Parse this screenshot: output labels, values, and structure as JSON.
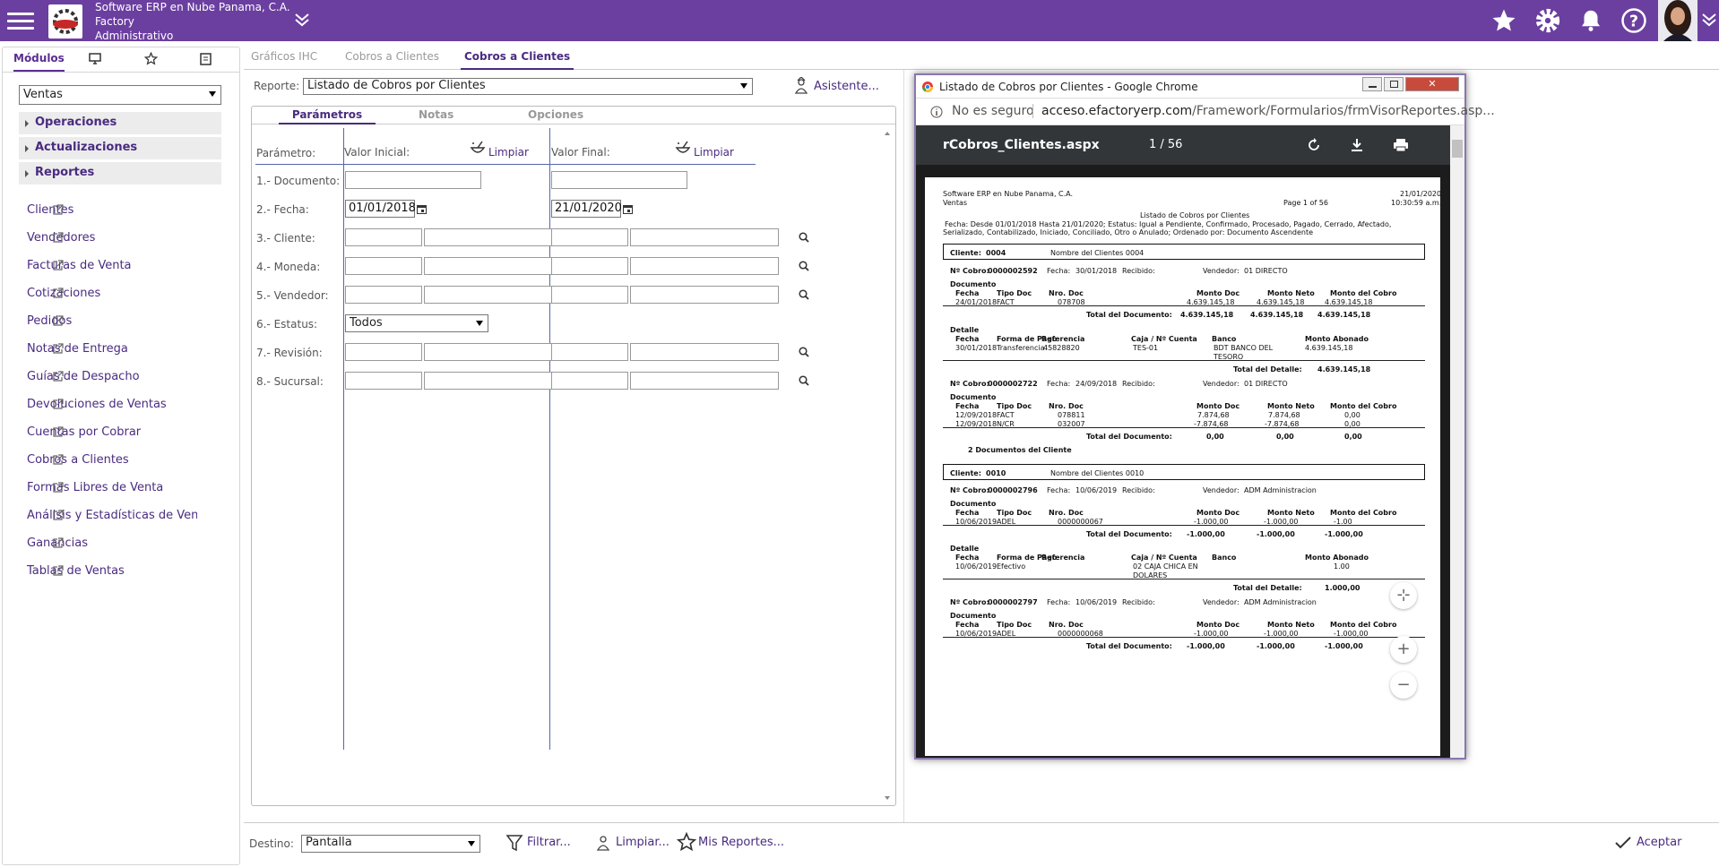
{
  "header": {
    "company_line1": "Software ERP en Nube Panama, C.A.",
    "company_line2": "Factory",
    "company_line3": "Administrativo"
  },
  "sidebar": {
    "tabs": [
      {
        "label": "Módulos"
      }
    ],
    "module_select": "Ventas",
    "groups": [
      {
        "label": "Operaciones"
      },
      {
        "label": "Actualizaciones"
      },
      {
        "label": "Reportes"
      }
    ],
    "items": [
      {
        "label": "Clientes"
      },
      {
        "label": "Vendedores"
      },
      {
        "label": "Facturas de Venta"
      },
      {
        "label": "Cotizaciones"
      },
      {
        "label": "Pedidos"
      },
      {
        "label": "Notas de Entrega"
      },
      {
        "label": "Guías de Despacho"
      },
      {
        "label": "Devoluciones de Ventas"
      },
      {
        "label": "Cuentas por Cobrar"
      },
      {
        "label": "Cobros a Clientes"
      },
      {
        "label": "Formas Libres de Venta"
      },
      {
        "label": "Análisis y Estadísticas de Ventas"
      },
      {
        "label": "Ganancias"
      },
      {
        "label": "Tablas de Ventas"
      }
    ]
  },
  "main": {
    "tabs": [
      {
        "label": "Gráficos IHC"
      },
      {
        "label": "Cobros a Clientes"
      },
      {
        "label": "Cobros a Clientes"
      }
    ],
    "report_label": "Reporte:",
    "report_value": "Listado de Cobros por Clientes",
    "wizard_label": "Asistente...",
    "panel_tabs": [
      {
        "label": "Parámetros"
      },
      {
        "label": "Notas"
      },
      {
        "label": "Opciones"
      }
    ],
    "param_header": "Parámetro:",
    "initial_header": "Valor Inicial:",
    "final_header": "Valor Final:",
    "clear_label": "Limpiar",
    "params": [
      {
        "label": "1.- Documento:"
      },
      {
        "label": "2.- Fecha:"
      },
      {
        "label": "3.- Cliente:"
      },
      {
        "label": "4.- Moneda:"
      },
      {
        "label": "5.- Vendedor:"
      },
      {
        "label": "6.- Estatus:"
      },
      {
        "label": "7.- Revisión:"
      },
      {
        "label": "8.- Sucursal:"
      }
    ],
    "date_initial": "01/01/2018",
    "date_final": "21/01/2020",
    "estatus_value": "Todos"
  },
  "bottom": {
    "destino_label": "Destino:",
    "destino_value": "Pantalla",
    "filter_label": "Filtrar...",
    "clear_label": "Limpiar...",
    "myreports_label": "Mis Reportes...",
    "accept_label": "Aceptar"
  },
  "pdf": {
    "window_title": "Listado de Cobros por Clientes - Google Chrome",
    "not_secure": "No es seguro",
    "url_host": "acceso.efactoryerp.com",
    "url_path": "/Framework/Formularios/frmVisorReportes.asp...",
    "filename": "rCobros_Clientes.aspx",
    "pages": "1 / 56",
    "doc": {
      "company": "Software ERP en Nube Panama, C.A.",
      "module": "Ventas",
      "date": "21/01/2020",
      "time": "10:30:59 a.m.",
      "page": "Page 1 of 56",
      "title": "Listado de Cobros por Clientes",
      "filter1": "Fecha: Desde 01/01/2018  Hasta 21/01/2020; Estatus: Igual a Pendiente, Confirmado, Procesado, Pagado, Cerrado, Afectado,",
      "filter2": "Serializado, Contabilizado, Iniciado, Conciliado, Otro o Anulado; Ordenado por: Documento Ascendente",
      "cliente_lbl": "Cliente:",
      "c1_code": "0004",
      "c1_name": "Nombre del Clientes 0004",
      "c2_code": "0010",
      "c2_name": "Nombre del Clientes 0010",
      "cobro_lbl": "Nº Cobro:",
      "fecha_lbl": "Fecha:",
      "recibido_lbl": "Recibido:",
      "vendedor_lbl": "Vendedor:",
      "documento_lbl": "Documento",
      "detalle_lbl": "Detalle",
      "h_fecha": "Fecha",
      "h_tipo": "Tipo Doc",
      "h_nro": "Nro. Doc",
      "h_mdoc": "Monto Doc",
      "h_mneto": "Monto Neto",
      "h_mcobro": "Monto del Cobro",
      "h_forma": "Forma de Pago",
      "h_ref": "Referencia",
      "h_caja": "Caja / Nº Cuenta",
      "h_banco": "Banco",
      "h_abonado": "Monto Abonado",
      "tot_doc": "Total del Documento:",
      "tot_det": "Total del Detalle:",
      "k1_num": "0000002592",
      "k1_fecha": "30/01/2018",
      "k1_vend": "01  DIRECTO",
      "k1_d_fecha": "24/01/2018",
      "k1_d_tipo": "FACT",
      "k1_d_nro": "078708",
      "k1_amt": "4.639.145,18",
      "k1_p_fecha": "30/01/2018",
      "k1_p_forma": "Transferencia",
      "k1_p_ref": "45828820",
      "k1_p_caja": "TES-01",
      "k1_p_banco": "BDT  BANCO DEL",
      "k1_p_banco2": "TESORO",
      "k2_num": "0000002722",
      "k2_fecha": "24/09/2018",
      "k2_vend": "01  DIRECTO",
      "k2_r1_fecha": "12/09/2018",
      "k2_r1_tipo": "FACT",
      "k2_r1_nro": "078811",
      "k2_r1_amt": "7.874,68",
      "k2_r2_fecha": "12/09/2018",
      "k2_r2_tipo": "N/CR",
      "k2_r2_nro": "032007",
      "k2_r2_amt": "-7.874,68",
      "zero": "0,00",
      "two_docs": "2 Documentos del Cliente",
      "k3_num": "0000002796",
      "k3_fecha": "10/06/2019",
      "k3_vend": "ADM  Administracion",
      "k3_d_fecha": "10/06/2019",
      "k3_d_tipo": "ADEL",
      "k3_d_nro": "0000000067",
      "neg1000": "-1.000,00",
      "pos1000": "1.000,00",
      "k3_d_cobro": "-1.00",
      "k3_p_forma": "Efectivo",
      "k3_p_caja": "02  CAJA CHICA EN",
      "k3_p_caja2": "DOLARES",
      "k3_p_abon": "1.00",
      "k4_num": "0000002797",
      "k4_fecha": "10/06/2019",
      "k4_vend": "ADM  Administracion",
      "k4_d_nro": "0000000068"
    }
  }
}
